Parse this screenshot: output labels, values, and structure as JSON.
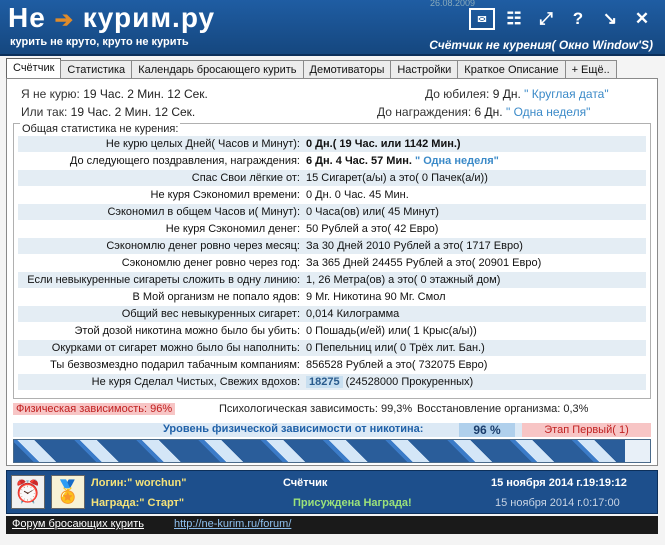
{
  "header": {
    "logo": "Не-курим.ру",
    "logo_left": "Не",
    "logo_right": "курим.ру",
    "slogan": "курить не круто, круто не курить",
    "window_title": "Счётчик не курения( Окно Window'S)",
    "stamp": "26.08.2009",
    "icons": [
      "envelope-icon",
      "tile-icon",
      "fullscreen-icon",
      "help-icon",
      "minimize-icon",
      "close-icon"
    ]
  },
  "tabs": [
    "Счётчик",
    "Статистика",
    "Календарь бросающего курить",
    "Демотиваторы",
    "Настройки",
    "Краткое Описание",
    "+ Ещё.."
  ],
  "summary": {
    "no_smoke_label": "Я не курю:",
    "no_smoke_value": "19 Час. 2 Мин. 12 Сек.",
    "or_label": "Или так:",
    "or_value": "19 Час. 2 Мин. 12 Сек.",
    "jubilee_label": "До юбилея:",
    "jubilee_value": "9 Дн.",
    "jubilee_name": "\" Круглая дата\"",
    "award_label": "До награждения:",
    "award_value": "6 Дн.",
    "award_name": "\" Одна неделя\""
  },
  "stats": {
    "title": "Общая статистика не курения:",
    "rows": [
      {
        "label": "Не курю целых Дней( Часов и Минут):",
        "value": "0 Дн.( 19 Час. или 1142 Мин.)"
      },
      {
        "label": "До следующего поздравления, награждения:",
        "value": "6 Дн. 4 Час. 57 Мин.",
        "extra": "\" Одна неделя\""
      },
      {
        "label": "Спас Свои лёгкие от:",
        "value": "15 Сигарет(а/ы) а это( 0 Пачек(а/и))"
      },
      {
        "label": "Не куря Сэкономил времени:",
        "value": "0 Дн. 0 Час. 45 Мин."
      },
      {
        "label": "Сэкономил в общем Часов и( Минут):",
        "value": "0 Часа(ов) или( 45 Минут)"
      },
      {
        "label": "Не куря Сэкономил денег:",
        "value": "50 Рублей а это( 42 Евро)"
      },
      {
        "label": "Сэкономлю денег ровно через месяц:",
        "value": "За 30 Дней 2010 Рублей а это( 1717 Евро)"
      },
      {
        "label": "Сэкономлю денег ровно через год:",
        "value": "За 365 Дней 24455 Рублей а это( 20901 Евро)"
      },
      {
        "label": "Если невыкуренные сигареты сложить в одну линию:",
        "value": "1, 26 Метра(ов)  а это( 0 этажный дом)"
      },
      {
        "label": "В Мой организм не попало ядов:",
        "value": "9 Мг. Никотина 90 Мг. Смол"
      },
      {
        "label": "Общий вес невыкуренных сигарет:",
        "value": "0,014 Килограмма"
      },
      {
        "label": "Этой дозой никотина можно было бы убить:",
        "value": "0 Пошадь(и/ей) или( 1 Крыс(а/ы))"
      },
      {
        "label": "Окурками от сигарет можно было бы наполнить:",
        "value": "0 Пепельниц или( 0 Трёх лит. Бан.)"
      },
      {
        "label": "Ты безвозмездно подарил табачным компаниям:",
        "value": "856528 Рублей а это( 732075 Евро)"
      },
      {
        "label": "Не куря Сделал Чистых, Свежих вдохов:",
        "value": "18275",
        "extra": "(24528000 Прокуренных)"
      }
    ]
  },
  "dependency": {
    "physical": "Физическая зависимость: 96%",
    "psychological": "Психологическая зависимость: 99,3%",
    "recovery": "Восстановление организма: 0,3%"
  },
  "nicotine": {
    "label": "Уровень физической зависимости от никотина:",
    "percent": "96 %",
    "stage": "Этап Первый( 1)",
    "progress_value": 0.96
  },
  "footer": {
    "login": "Логин:\" worchun\"",
    "award": "Награда:\" Старт\"",
    "counter": "Счётчик",
    "awarded": "Присуждена Награда!",
    "date1": "15 ноября 2014 г.19:19:12",
    "date2": "15 ноября 2014 г.0:17:00"
  },
  "linkbar": {
    "forum_label": "Форум бросающих курить",
    "forum_url": "http://ne-kurim.ru/forum/"
  }
}
